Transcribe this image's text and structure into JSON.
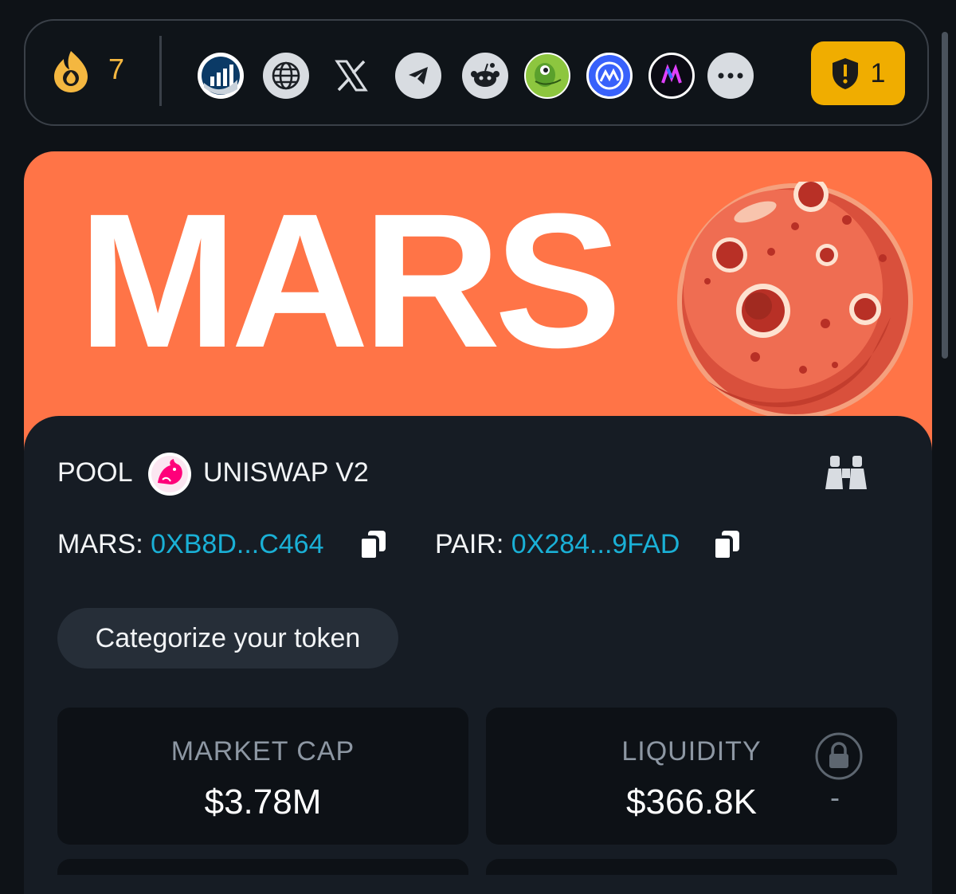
{
  "topbar": {
    "hot_count": "7",
    "socials": [
      "dextools-icon",
      "website-icon",
      "x-icon",
      "telegram-icon",
      "reddit-icon",
      "coingecko-icon",
      "coinmarketcap-icon",
      "moontok-icon",
      "more-icon"
    ],
    "warning_count": "1"
  },
  "banner": {
    "text": "MARS"
  },
  "pool": {
    "label": "POOL",
    "dex": "UNISWAP V2"
  },
  "addresses": {
    "token_label": "MARS:",
    "token_value": "0XB8D...C464",
    "pair_label": "PAIR:",
    "pair_value": "0X284...9FAD"
  },
  "categorize": {
    "label": "Categorize your token"
  },
  "stats": {
    "market_cap_title": "MARKET CAP",
    "market_cap_value": "$3.78M",
    "liquidity_title": "LIQUIDITY",
    "liquidity_value": "$366.8K",
    "liquidity_lock": "-"
  },
  "colors": {
    "accent": "#1ab0d6",
    "banner": "#ff7447",
    "warning": "#f0ad00",
    "hot": "#f4b740"
  }
}
